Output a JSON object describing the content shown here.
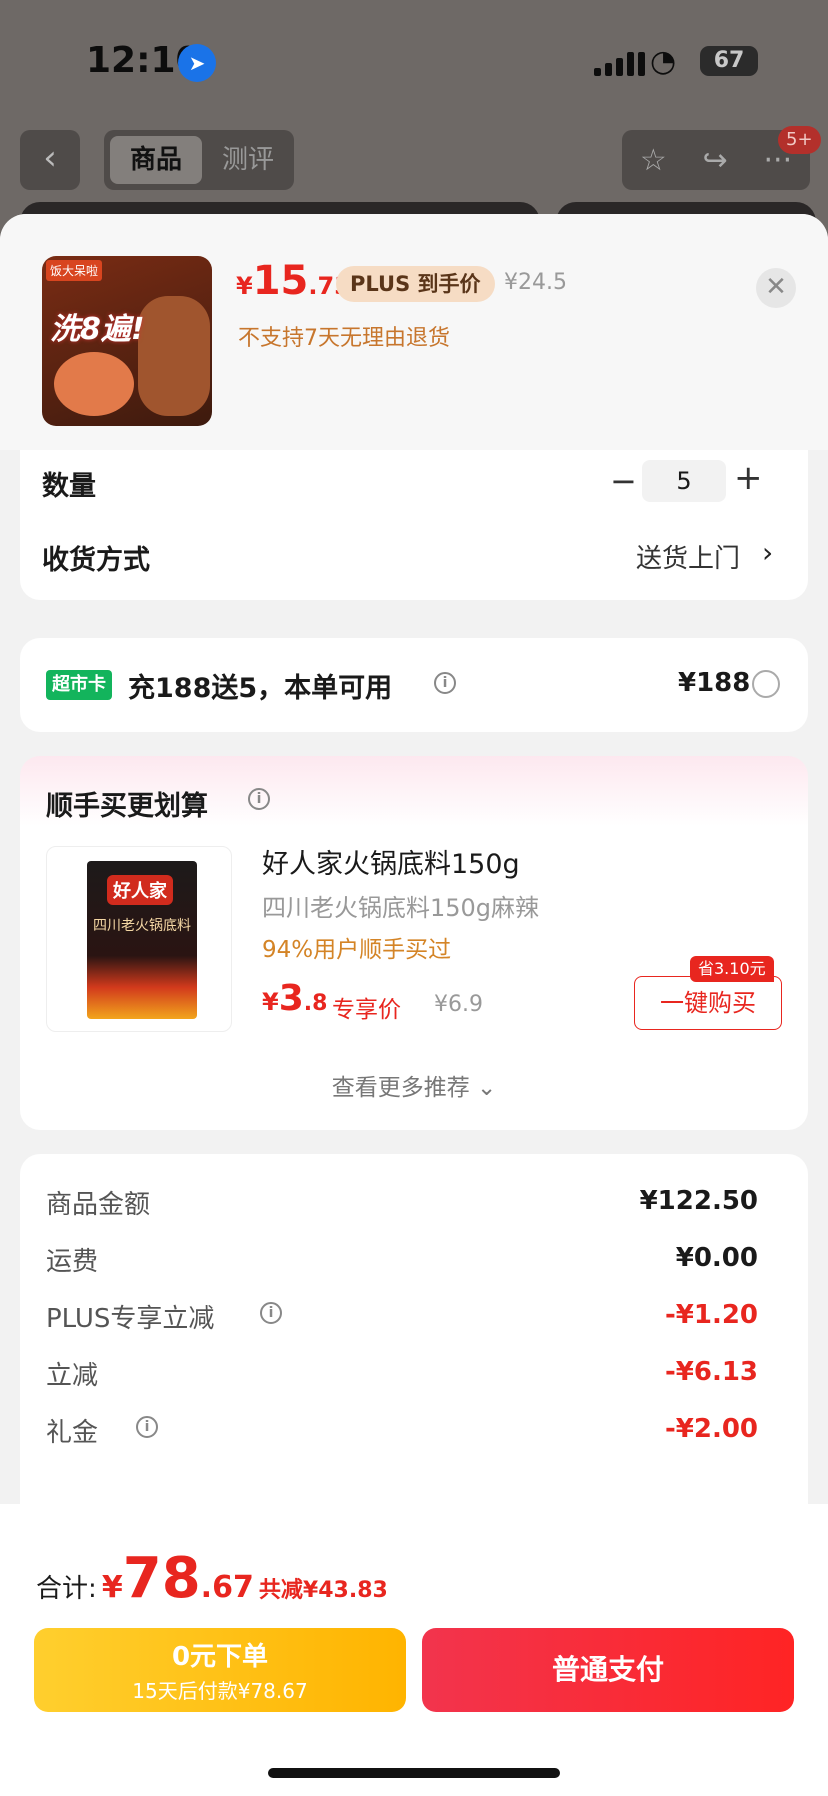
{
  "status_bar": {
    "time": "12:10",
    "battery": "67"
  },
  "nav": {
    "back_icon": "chevron-left-icon",
    "tab_active": "商品",
    "tab_other": "测评",
    "badge": "5+"
  },
  "product": {
    "thumb_brand": "饭大呆啦",
    "thumb_text": "洗8遍!",
    "price_symbol": "¥",
    "price_int": "15",
    "price_dec": ".73",
    "plus_tag": "PLUS 到手价",
    "original_price": "¥24.5",
    "notice": "不支持7天无理由退货"
  },
  "quantity": {
    "label": "数量",
    "minus": "−",
    "value": "5",
    "plus": "+"
  },
  "delivery": {
    "label": "收货方式",
    "value": "送货上门"
  },
  "market_card": {
    "tag": "超市卡",
    "text": "充188送5，本单可用",
    "price": "¥188"
  },
  "recommend": {
    "title": "顺手买更划算",
    "item": {
      "pack_brand": "好人家",
      "pack_text": "四川老火锅底料",
      "name": "好人家火锅底料150g",
      "subtitle": "四川老火锅底料150g麻辣",
      "percent": "94%用户顺手买过",
      "price_symbol": "¥",
      "price_int": "3",
      "price_dec": ".8",
      "exclusive": "专享价",
      "original": "¥6.9",
      "save_badge": "省3.10元",
      "buy_label": "一键购买"
    },
    "more": "查看更多推荐"
  },
  "summary": [
    {
      "label": "商品金额",
      "value": "¥122.50",
      "info": false,
      "red": false
    },
    {
      "label": "运费",
      "value": "¥0.00",
      "info": false,
      "red": false
    },
    {
      "label": "PLUS专享立减",
      "value": "-¥1.20",
      "info": true,
      "red": true
    },
    {
      "label": "立减",
      "value": "-¥6.13",
      "info": false,
      "red": true
    },
    {
      "label": "礼金",
      "value": "-¥2.00",
      "info": true,
      "red": true
    }
  ],
  "footer": {
    "total_label": "合计:",
    "total_symbol": "¥",
    "total_int": "78",
    "total_dec": ".67",
    "discount": "共减¥43.83",
    "btn_later_l1": "0元下单",
    "btn_later_l2": "15天后付款¥78.67",
    "btn_pay": "普通支付"
  },
  "colors": {
    "accent_red": "#e8261f",
    "green_tag": "#13b45c",
    "yellow_btn": "#ffc107"
  }
}
